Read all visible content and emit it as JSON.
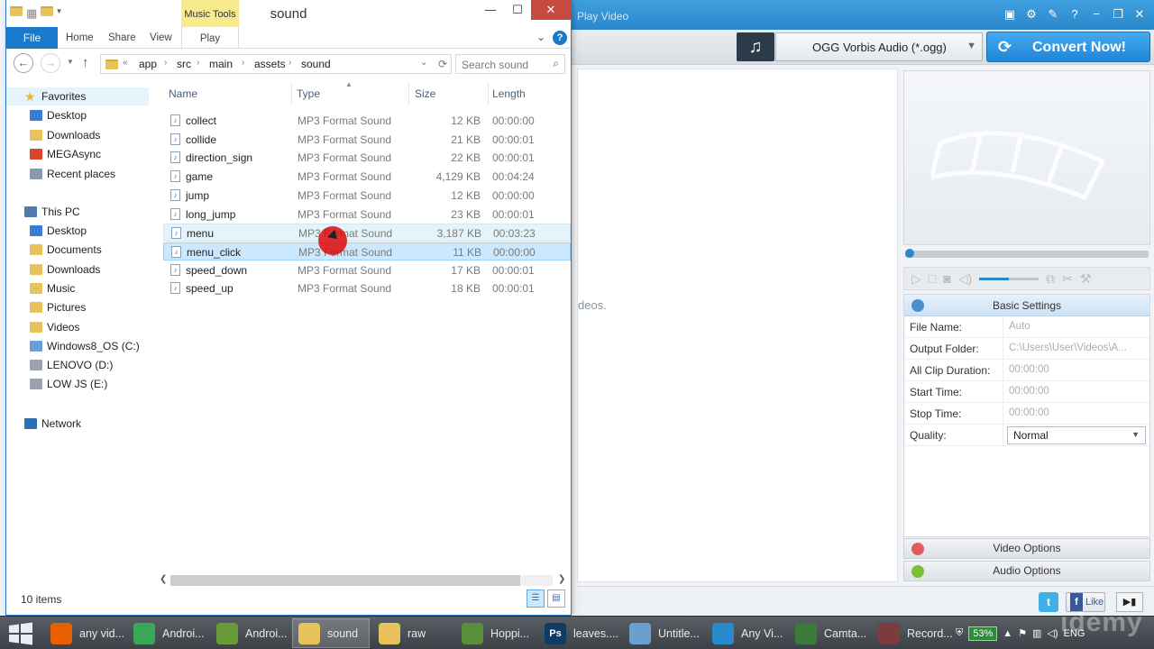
{
  "converter": {
    "title_fragment": "Play Video",
    "format_label": "OGG Vorbis Audio (*.ogg)",
    "convert_label": "Convert Now!",
    "hint_fragment": "deos.",
    "basic_settings": {
      "title": "Basic Settings",
      "rows": [
        {
          "label": "File Name:",
          "value": "Auto"
        },
        {
          "label": "Output Folder:",
          "value": "C:\\Users\\User\\Videos\\A..."
        },
        {
          "label": "All Clip Duration:",
          "value": "00:00:00"
        },
        {
          "label": "Start Time:",
          "value": "00:00:00"
        },
        {
          "label": "Stop Time:",
          "value": "00:00:00"
        },
        {
          "label": "Quality:",
          "value": "Normal"
        }
      ]
    },
    "video_options": "Video Options",
    "audio_options": "Audio Options",
    "like_label": "Like",
    "volume": 0.5
  },
  "explorer": {
    "title": "sound",
    "contextual_tab": "Music Tools",
    "tabs": {
      "file": "File",
      "home": "Home",
      "share": "Share",
      "view": "View",
      "play": "Play"
    },
    "breadcrumb": [
      "app",
      "src",
      "main",
      "assets",
      "sound"
    ],
    "search_placeholder": "Search sound",
    "columns": {
      "name": "Name",
      "type": "Type",
      "size": "Size",
      "length": "Length"
    },
    "nav": {
      "favorites": "Favorites",
      "fav_items": [
        "Desktop",
        "Downloads",
        "MEGAsync",
        "Recent places"
      ],
      "this_pc": "This PC",
      "pc_items": [
        "Desktop",
        "Documents",
        "Downloads",
        "Music",
        "Pictures",
        "Videos",
        "Windows8_OS (C:)",
        "LENOVO (D:)",
        "LOW JS (E:)"
      ],
      "network": "Network"
    },
    "files": [
      {
        "name": "collect",
        "type": "MP3 Format Sound",
        "size": "12 KB",
        "length": "00:00:00"
      },
      {
        "name": "collide",
        "type": "MP3 Format Sound",
        "size": "21 KB",
        "length": "00:00:01"
      },
      {
        "name": "direction_sign",
        "type": "MP3 Format Sound",
        "size": "22 KB",
        "length": "00:00:01"
      },
      {
        "name": "game",
        "type": "MP3 Format Sound",
        "size": "4,129 KB",
        "length": "00:04:24"
      },
      {
        "name": "jump",
        "type": "MP3 Format Sound",
        "size": "12 KB",
        "length": "00:00:00"
      },
      {
        "name": "long_jump",
        "type": "MP3 Format Sound",
        "size": "23 KB",
        "length": "00:00:01"
      },
      {
        "name": "menu",
        "type": "MP3 Format Sound",
        "size": "3,187 KB",
        "length": "00:03:23"
      },
      {
        "name": "menu_click",
        "type": "MP3 Format Sound",
        "size": "11 KB",
        "length": "00:00:00"
      },
      {
        "name": "speed_down",
        "type": "MP3 Format Sound",
        "size": "17 KB",
        "length": "00:00:01"
      },
      {
        "name": "speed_up",
        "type": "MP3 Format Sound",
        "size": "18 KB",
        "length": "00:00:01"
      }
    ],
    "item_count": "10 items"
  },
  "taskbar": {
    "items": [
      {
        "label": "any vid...",
        "icon": "firefox-icon",
        "color": "#e66000"
      },
      {
        "label": "Androi...",
        "icon": "chrome-icon",
        "color": "#3aa757"
      },
      {
        "label": "Androi...",
        "icon": "download-folder-icon",
        "color": "#6a9a3a"
      },
      {
        "label": "sound",
        "icon": "folder-icon",
        "color": "#e8c25a"
      },
      {
        "label": "raw",
        "icon": "folder-icon",
        "color": "#e8c25a"
      },
      {
        "label": "Hoppi...",
        "icon": "android-studio-icon",
        "color": "#5a8f3a"
      },
      {
        "label": "leaves....",
        "icon": "photoshop-icon",
        "color": "#0f3b66"
      },
      {
        "label": "Untitle...",
        "icon": "notepad-icon",
        "color": "#6a9fd0"
      },
      {
        "label": "Any Vi...",
        "icon": "any-video-converter-icon",
        "color": "#2a88cc"
      },
      {
        "label": "Camta...",
        "icon": "camtasia-icon",
        "color": "#3c7a3c"
      },
      {
        "label": "Record...",
        "icon": "recorder-icon",
        "color": "#7a3c3c"
      }
    ],
    "battery": "53%",
    "language": "ENG"
  },
  "watermark": "ıdemy"
}
